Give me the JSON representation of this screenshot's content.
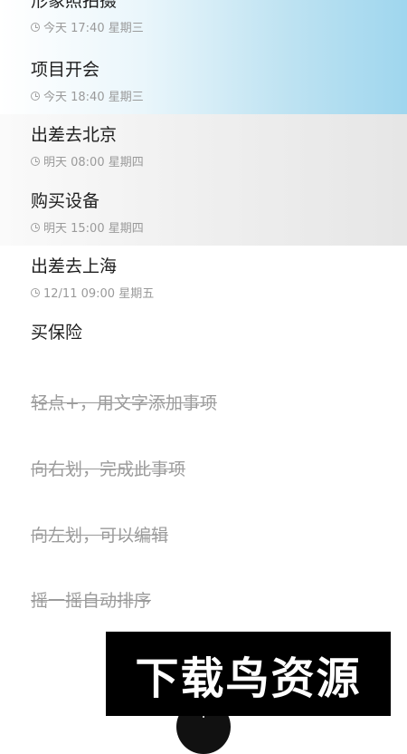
{
  "colors": {
    "highlight_blue": "#9fd6ee",
    "highlight_grey": "#e6e6e6",
    "text_primary": "#1e1e1e",
    "text_meta": "#9a9a9a",
    "watermark_bg": "#000000"
  },
  "tasks": [
    {
      "title": "形象照拍摄",
      "time": "今天 17:40 星期三",
      "icon": "clock-icon"
    },
    {
      "title": "项目开会",
      "time": "今天 18:40 星期三",
      "icon": "clock-icon"
    },
    {
      "title": "出差去北京",
      "time": "明天 08:00 星期四",
      "icon": "clock-icon"
    },
    {
      "title": "购买设备",
      "time": "明天 15:00 星期四",
      "icon": "clock-icon"
    },
    {
      "title": "出差去上海",
      "time": "12/11 09:00 星期五",
      "icon": "clock-icon"
    },
    {
      "title": "买保险",
      "time": "",
      "icon": ""
    }
  ],
  "hints": [
    "轻点+，用文字添加事项",
    "向右划，完成此事项",
    "向左划，可以编辑",
    "摇一摇自动排序"
  ],
  "watermark": {
    "text": "下载鸟资源"
  },
  "add_button": {
    "label": "+",
    "icon": "plus-icon"
  }
}
